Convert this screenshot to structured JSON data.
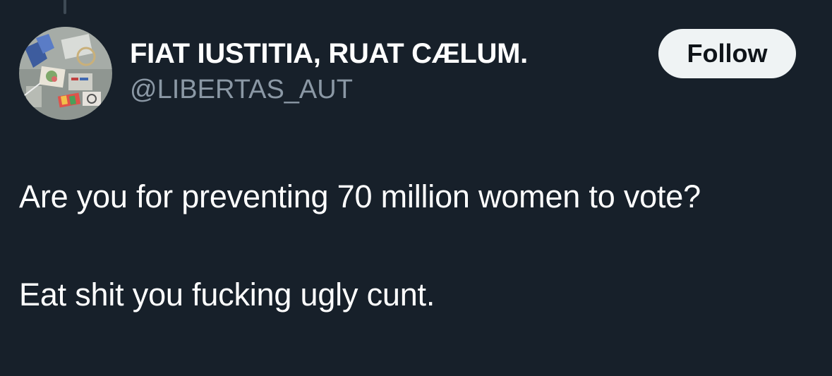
{
  "tweet": {
    "author": {
      "display_name": "FIAT IUSTITIA, RUAT CÆLUM.",
      "handle": "@LIBERTAS_AUT",
      "avatar_icon": "profile-photo-colorful-papers"
    },
    "follow_label": "Follow",
    "text_lines": [
      "Are you for preventing 70 million women to vote?",
      "Eat shit you fucking ugly cunt."
    ]
  },
  "colors": {
    "background": "#17202a",
    "name_text": "#ffffff",
    "handle_text": "#8b98a5",
    "follow_bg": "#eff3f4",
    "follow_text": "#0f1419"
  }
}
